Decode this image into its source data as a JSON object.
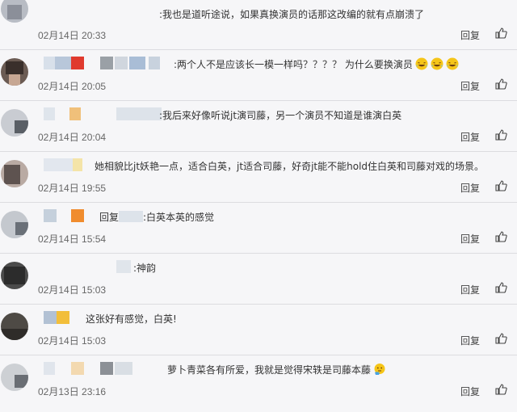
{
  "comments": [
    {
      "text": ":我也是道听途说，如果真换演员的话那这改编的就有点崩溃了",
      "time": "02月14日 20:33",
      "reply": "回复"
    },
    {
      "text": ":两个人不是应该长一模一样吗？？？？ 为什么要换演员",
      "time": "02月14日 20:05",
      "reply": "回复",
      "emoji": "laughing-tears-emoji"
    },
    {
      "text": ":我后来好像听说jt演司藤，另一个演员不知道是谁演白英",
      "time": "02月14日 20:04",
      "reply": "回复"
    },
    {
      "text": "她相貌比jt妖艳一点，适合白英，jt适合司藤，好奇jt能不能hold住白英和司藤对戏的场景。",
      "time": "02月14日 19:55",
      "reply": "回复"
    },
    {
      "prefix": "回复",
      "text": ":白英本英的感觉",
      "time": "02月14日 15:54",
      "reply": "回复"
    },
    {
      "text": ":神韵",
      "time": "02月14日 15:03",
      "reply": "回复"
    },
    {
      "text": "这张好有感觉，白英!",
      "time": "02月14日 15:03",
      "reply": "回复"
    },
    {
      "text": "萝卜青菜各有所爱，我就是觉得宋轶是司藤本藤",
      "time": "02月13日 23:16",
      "reply": "回复",
      "emoji": "thinking-face-emoji"
    }
  ],
  "colors": {
    "background": "#f6f6f8",
    "divider": "#dcdce0",
    "time": "#666666",
    "emoji": "#f5c518"
  },
  "icons": {
    "like": "thumbs-up-icon"
  }
}
